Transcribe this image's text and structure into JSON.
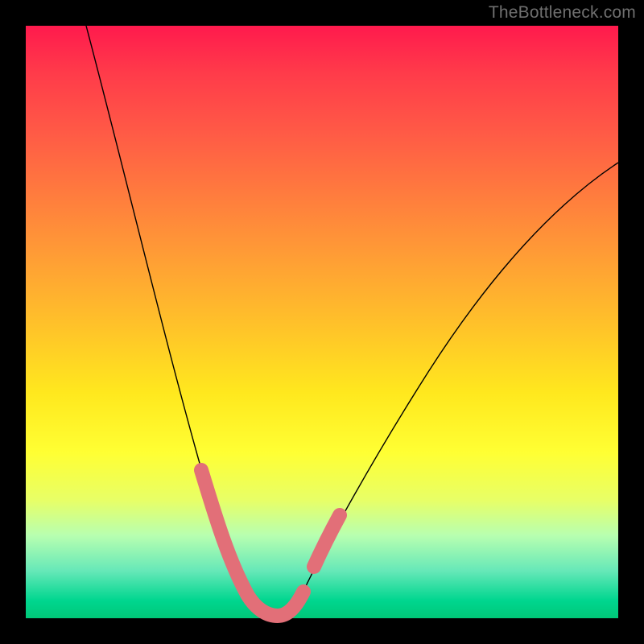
{
  "watermark": "TheBottleneck.com",
  "chart_data": {
    "type": "line",
    "title": "",
    "xlabel": "",
    "ylabel": "",
    "xlim": [
      0,
      100
    ],
    "ylim": [
      0,
      100
    ],
    "series": [
      {
        "name": "bottleneck-curve",
        "x": [
          10,
          15,
          20,
          25,
          28,
          30,
          32,
          34,
          36,
          38,
          40,
          42,
          44,
          48,
          55,
          65,
          80,
          95,
          100
        ],
        "values": [
          100,
          85,
          70,
          52,
          38,
          26,
          16,
          8,
          3,
          1,
          1,
          2,
          4,
          9,
          18,
          32,
          50,
          64,
          68
        ]
      }
    ],
    "highlight": {
      "name": "trough-marker",
      "color": "#e26f78",
      "x": [
        30,
        32.5,
        35,
        36.5,
        38,
        39.5,
        41,
        42.5,
        44,
        45,
        46
      ],
      "values": [
        26,
        14,
        6,
        3,
        1,
        1,
        2,
        3,
        5,
        8,
        12
      ]
    }
  }
}
